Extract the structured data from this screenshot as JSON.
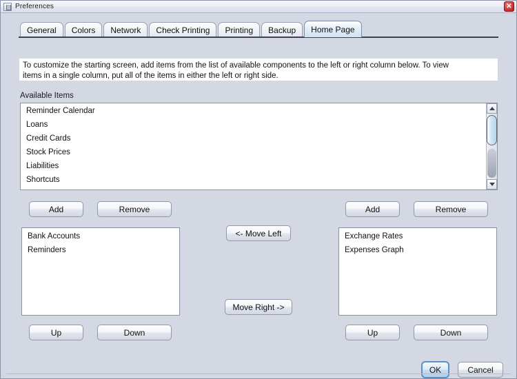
{
  "window": {
    "title": "Preferences",
    "icon": "app-icon",
    "close_label": "✕"
  },
  "tabs": [
    {
      "label": "General",
      "selected": false
    },
    {
      "label": "Colors",
      "selected": false
    },
    {
      "label": "Network",
      "selected": false
    },
    {
      "label": "Check Printing",
      "selected": false
    },
    {
      "label": "Printing",
      "selected": false
    },
    {
      "label": "Backup",
      "selected": false
    },
    {
      "label": "Home Page",
      "selected": true
    }
  ],
  "instructions": {
    "line1": "To customize the starting screen, add items from the list of available components to the left or right column below.  To view",
    "line2": "items in a single column, put all of the items in either the left or right side."
  },
  "available": {
    "label": "Available Items",
    "items": [
      "Reminder Calendar",
      "Loans",
      "Credit Cards",
      "Stock Prices",
      "Liabilities",
      "Shortcuts"
    ],
    "scrollbar": {
      "up_arrow": "scroll-up-arrow",
      "down_arrow": "scroll-down-arrow"
    }
  },
  "left_column": {
    "add_label": "Add",
    "remove_label": "Remove",
    "items": [
      "Bank Accounts",
      "Reminders"
    ],
    "up_label": "Up",
    "down_label": "Down"
  },
  "right_column": {
    "add_label": "Add",
    "remove_label": "Remove",
    "items": [
      "Exchange Rates",
      "Expenses Graph"
    ],
    "up_label": "Up",
    "down_label": "Down"
  },
  "move_buttons": {
    "move_left_label": "<- Move Left",
    "move_right_label": "Move Right ->"
  },
  "dialog_buttons": {
    "ok_label": "OK",
    "cancel_label": "Cancel"
  },
  "colors": {
    "panel_background": "#d4d8e2",
    "selected_tab": "#cfe2f3",
    "default_button_border": "#5b8fc9",
    "close_button": "#d03c3c",
    "list_background": "#ffffff",
    "scroll_thumb": "#b6d6ec"
  }
}
